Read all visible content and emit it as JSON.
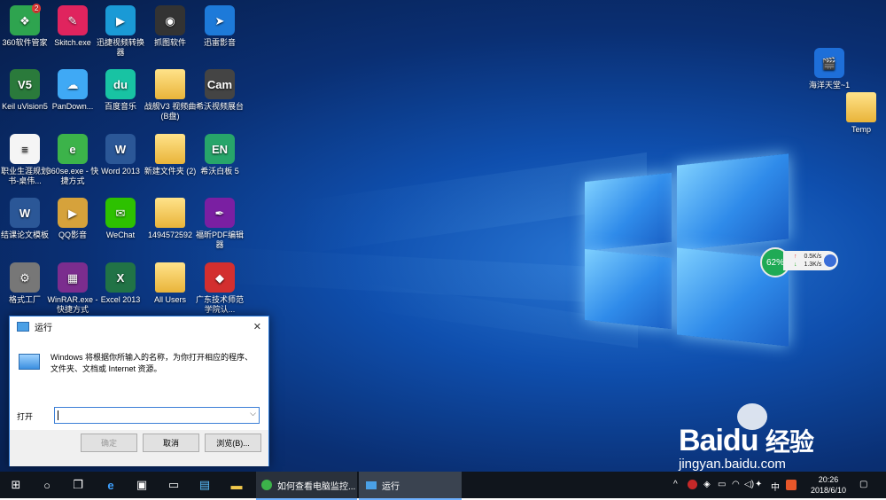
{
  "desktop": {
    "icons": [
      {
        "label": "360软件管家",
        "badge": "2",
        "color": "#2ea44f",
        "glyph": "❖"
      },
      {
        "label": "Skitch.exe",
        "color": "#e0245e",
        "glyph": "✎"
      },
      {
        "label": "迅捷视频转换器",
        "color": "#1a9ad6",
        "glyph": "▶"
      },
      {
        "label": "抓图软件",
        "color": "#333333",
        "glyph": "◉"
      },
      {
        "label": "迅雷影音",
        "color": "#1d7ad9",
        "glyph": "➤"
      },
      {
        "label": "Keil uVision5",
        "color": "#2a7a3b",
        "glyph": "V5"
      },
      {
        "label": "PanDown...",
        "color": "#3fa9f5",
        "glyph": "☁"
      },
      {
        "label": "百度音乐",
        "color": "#18c3a3",
        "glyph": "du"
      },
      {
        "label": "战舰V3 视频曲(B盘)",
        "color": "#e9b43a",
        "glyph": ""
      },
      {
        "label": "希沃视频展台",
        "color": "#444444",
        "glyph": "Cam"
      },
      {
        "label": "职业生涯规划书-桌伟...",
        "color": "#f5f5f5",
        "glyph": "≡"
      },
      {
        "label": "360se.exe - 快捷方式",
        "color": "#3cb34a",
        "glyph": "e"
      },
      {
        "label": "Word 2013",
        "color": "#2b5797",
        "glyph": "W"
      },
      {
        "label": "新建文件夹 (2)",
        "color": "#e9b43a",
        "glyph": ""
      },
      {
        "label": "希沃白板 5",
        "color": "#27a56a",
        "glyph": "EN"
      },
      {
        "label": "结课论文模板",
        "color": "#2b5797",
        "glyph": "W"
      },
      {
        "label": "QQ影音",
        "color": "#d6a23b",
        "glyph": "▶"
      },
      {
        "label": "WeChat",
        "color": "#2dc100",
        "glyph": "✉"
      },
      {
        "label": "1494572592",
        "color": "#e9b43a",
        "glyph": ""
      },
      {
        "label": "福昕PDF编辑器",
        "color": "#7a1fa2",
        "glyph": "✒"
      },
      {
        "label": "格式工厂",
        "color": "#777777",
        "glyph": "⚙"
      },
      {
        "label": "WinRAR.exe - 快捷方式",
        "color": "#7b2d8e",
        "glyph": "▦"
      },
      {
        "label": "Excel 2013",
        "color": "#217346",
        "glyph": "X"
      },
      {
        "label": "All Users",
        "color": "#e9b43a",
        "glyph": ""
      },
      {
        "label": "广东技术师范学院认...",
        "color": "#d32f2f",
        "glyph": "◆"
      }
    ],
    "right_icons": [
      {
        "label": "海洋天堂~1",
        "color": "#1e6fd9",
        "glyph": "🎬"
      },
      {
        "label": "Temp",
        "color": "#e9b43a",
        "glyph": ""
      }
    ]
  },
  "net_widget": {
    "percent": "62%",
    "upload": "0.5K/s",
    "download": "1.3K/s",
    "up_arrow": "↑",
    "down_arrow": "↓"
  },
  "run_dialog": {
    "title": "运行",
    "description": "Windows 将根据你所输入的名称，为你打开相应的程序、文件夹、文档或 Internet 资源。",
    "open_label": "打开",
    "input_value": "",
    "ok": "确定",
    "cancel": "取消",
    "browse": "浏览(B)...",
    "close": "✕"
  },
  "taskbar": {
    "tasks": [
      {
        "label": "如何查看电脑监控..."
      },
      {
        "label": "运行"
      }
    ],
    "time": "20:26",
    "date": "2018/6/10",
    "ime": "中",
    "input_mode": "英"
  },
  "watermark": {
    "brand": "Bai",
    "brand2": "du",
    "text": "经验",
    "url": "jingyan.baidu.com"
  }
}
